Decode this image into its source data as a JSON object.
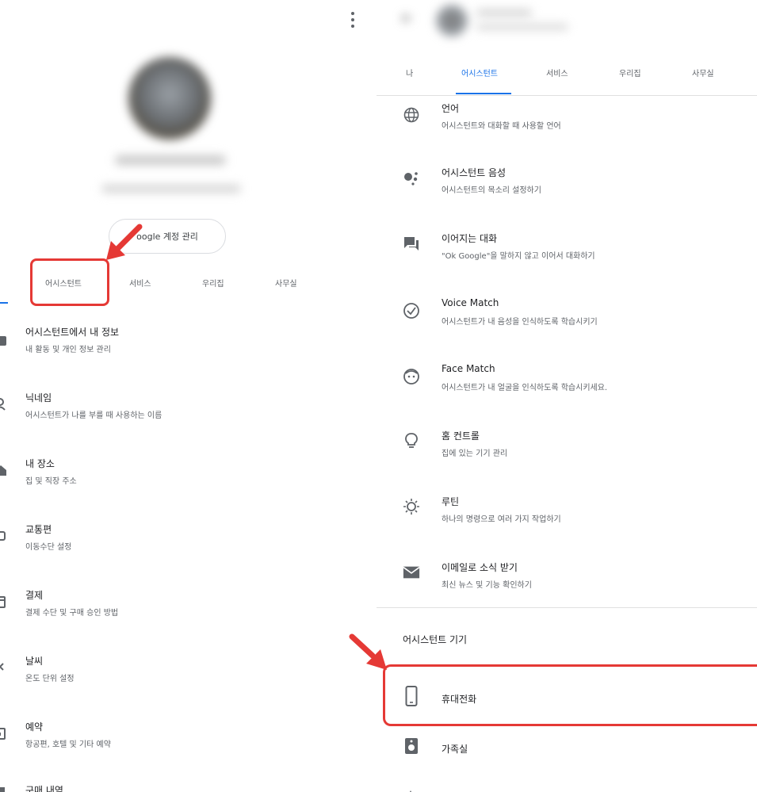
{
  "left": {
    "manage_account_label": "oogle 계정 관리",
    "tabs": [
      {
        "label": "어시스턴트"
      },
      {
        "label": "서비스"
      },
      {
        "label": "우리집"
      },
      {
        "label": "사무실"
      }
    ],
    "items": [
      {
        "title": "어시스턴트에서 내 정보",
        "subtitle": "내 활동 및 개인 정보 관리",
        "icon": "account-icon"
      },
      {
        "title": "닉네임",
        "subtitle": "어시스턴트가 나를 부를 때 사용하는 이름",
        "icon": "person-icon"
      },
      {
        "title": "내 장소",
        "subtitle": "집 및 직장 주소",
        "icon": "home-icon"
      },
      {
        "title": "교통편",
        "subtitle": "이동수단 설정",
        "icon": "car-icon"
      },
      {
        "title": "결제",
        "subtitle": "결제 수단 및 구매 승인 방법",
        "icon": "card-icon"
      },
      {
        "title": "날씨",
        "subtitle": "온도 단위 설정",
        "icon": "weather-icon"
      },
      {
        "title": "예약",
        "subtitle": "항공편, 호텔 및 기타 예약",
        "icon": "calendar-icon"
      },
      {
        "title": "구매 내역",
        "subtitle": "",
        "icon": "receipt-icon"
      }
    ]
  },
  "right": {
    "tabs": [
      {
        "label": "나"
      },
      {
        "label": "어시스턴트"
      },
      {
        "label": "서비스"
      },
      {
        "label": "우리집"
      },
      {
        "label": "사무실"
      }
    ],
    "items": [
      {
        "title": "언어",
        "subtitle": "어시스턴트와 대화할 때 사용할 언어",
        "icon": "globe-icon"
      },
      {
        "title": "어시스턴트 음성",
        "subtitle": "어시스턴트의 목소리 설정하기",
        "icon": "assistant-dots-icon"
      },
      {
        "title": "이어지는 대화",
        "subtitle": "\"Ok Google\"을 말하지 않고 이어서 대화하기",
        "icon": "chat-icon"
      },
      {
        "title": "Voice Match",
        "subtitle": "어시스턴트가 내 음성을 인식하도록 학습시키기",
        "icon": "voice-match-icon"
      },
      {
        "title": "Face Match",
        "subtitle": "어시스턴트가 내 얼굴을 인식하도록 학습시키세요.",
        "icon": "face-icon"
      },
      {
        "title": "홈 컨트롤",
        "subtitle": "집에 있는 기기 관리",
        "icon": "lightbulb-icon"
      },
      {
        "title": "루틴",
        "subtitle": "하나의 명령으로 여러 가지 작업하기",
        "icon": "routine-icon"
      },
      {
        "title": "이메일로 소식 받기",
        "subtitle": "최신 뉴스 및 기능 확인하기",
        "icon": "mail-icon"
      }
    ],
    "devices_header": "어시스턴트 기기",
    "devices": [
      {
        "title": "휴대전화",
        "icon": "phone-icon"
      },
      {
        "title": "가족실",
        "icon": "speaker-icon"
      }
    ]
  },
  "colors": {
    "accent": "#1a73e8",
    "highlight": "#e53935"
  }
}
